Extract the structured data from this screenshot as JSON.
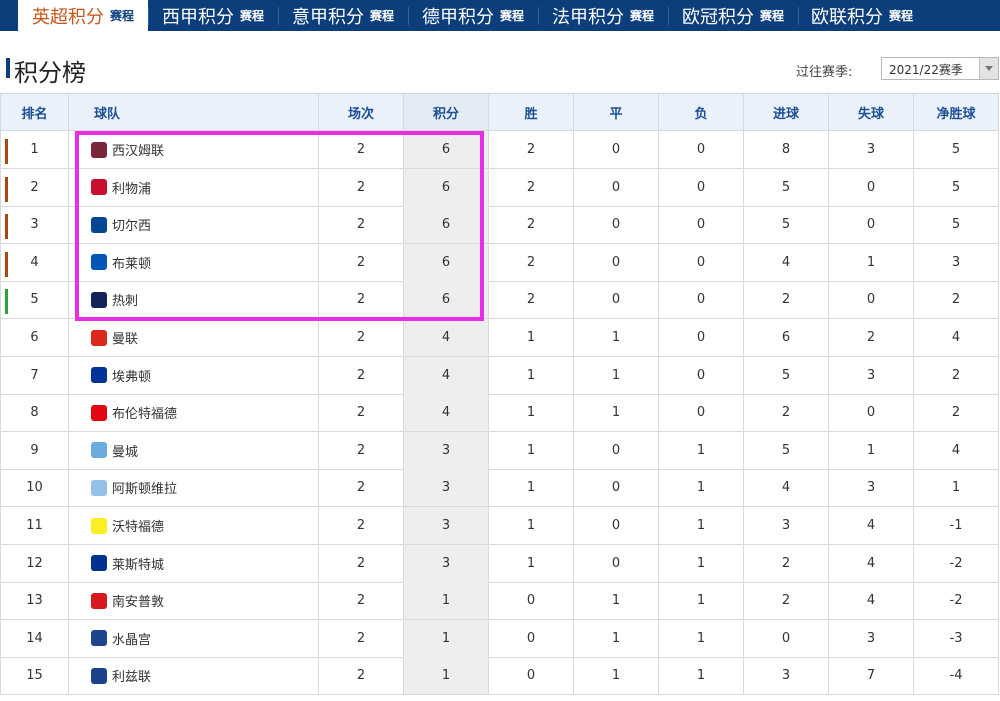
{
  "nav": [
    {
      "label": "英超积分",
      "sub": "赛程",
      "active": true
    },
    {
      "label": "西甲积分",
      "sub": "赛程",
      "active": false
    },
    {
      "label": "意甲积分",
      "sub": "赛程",
      "active": false
    },
    {
      "label": "德甲积分",
      "sub": "赛程",
      "active": false
    },
    {
      "label": "法甲积分",
      "sub": "赛程",
      "active": false
    },
    {
      "label": "欧冠积分",
      "sub": "赛程",
      "active": false
    },
    {
      "label": "欧联积分",
      "sub": "赛程",
      "active": false
    }
  ],
  "title": "积分榜",
  "season_label": "过往赛季:",
  "season_value": "2021/22赛季",
  "headers": [
    "排名",
    "球队",
    "场次",
    "积分",
    "胜",
    "平",
    "负",
    "进球",
    "失球",
    "净胜球"
  ],
  "rows": [
    {
      "rank": "1",
      "team": "西汉姆联",
      "played": "2",
      "points": "6",
      "win": "2",
      "draw": "0",
      "loss": "0",
      "gf": "8",
      "ga": "3",
      "gd": "5",
      "zone": "#a8480f",
      "crest": "#7a263a"
    },
    {
      "rank": "2",
      "team": "利物浦",
      "played": "2",
      "points": "6",
      "win": "2",
      "draw": "0",
      "loss": "0",
      "gf": "5",
      "ga": "0",
      "gd": "5",
      "zone": "#a8480f",
      "crest": "#c8102e"
    },
    {
      "rank": "3",
      "team": "切尔西",
      "played": "2",
      "points": "6",
      "win": "2",
      "draw": "0",
      "loss": "0",
      "gf": "5",
      "ga": "0",
      "gd": "5",
      "zone": "#a8480f",
      "crest": "#034694"
    },
    {
      "rank": "4",
      "team": "布莱顿",
      "played": "2",
      "points": "6",
      "win": "2",
      "draw": "0",
      "loss": "0",
      "gf": "4",
      "ga": "1",
      "gd": "3",
      "zone": "#a8480f",
      "crest": "#0057b8"
    },
    {
      "rank": "5",
      "team": "热刺",
      "played": "2",
      "points": "6",
      "win": "2",
      "draw": "0",
      "loss": "0",
      "gf": "2",
      "ga": "0",
      "gd": "2",
      "zone": "#2aa33a",
      "crest": "#132257"
    },
    {
      "rank": "6",
      "team": "曼联",
      "played": "2",
      "points": "4",
      "win": "1",
      "draw": "1",
      "loss": "0",
      "gf": "6",
      "ga": "2",
      "gd": "4",
      "zone": "",
      "crest": "#da291c"
    },
    {
      "rank": "7",
      "team": "埃弗顿",
      "played": "2",
      "points": "4",
      "win": "1",
      "draw": "1",
      "loss": "0",
      "gf": "5",
      "ga": "3",
      "gd": "2",
      "zone": "",
      "crest": "#003399"
    },
    {
      "rank": "8",
      "team": "布伦特福德",
      "played": "2",
      "points": "4",
      "win": "1",
      "draw": "1",
      "loss": "0",
      "gf": "2",
      "ga": "0",
      "gd": "2",
      "zone": "",
      "crest": "#e30613"
    },
    {
      "rank": "9",
      "team": "曼城",
      "played": "2",
      "points": "3",
      "win": "1",
      "draw": "0",
      "loss": "1",
      "gf": "5",
      "ga": "1",
      "gd": "4",
      "zone": "",
      "crest": "#6cabdd"
    },
    {
      "rank": "10",
      "team": "阿斯顿维拉",
      "played": "2",
      "points": "3",
      "win": "1",
      "draw": "0",
      "loss": "1",
      "gf": "4",
      "ga": "3",
      "gd": "1",
      "zone": "",
      "crest": "#95bfe5"
    },
    {
      "rank": "11",
      "team": "沃特福德",
      "played": "2",
      "points": "3",
      "win": "1",
      "draw": "0",
      "loss": "1",
      "gf": "3",
      "ga": "4",
      "gd": "-1",
      "zone": "",
      "crest": "#fbee23"
    },
    {
      "rank": "12",
      "team": "莱斯特城",
      "played": "2",
      "points": "3",
      "win": "1",
      "draw": "0",
      "loss": "1",
      "gf": "2",
      "ga": "4",
      "gd": "-2",
      "zone": "",
      "crest": "#003090"
    },
    {
      "rank": "13",
      "team": "南安普敦",
      "played": "2",
      "points": "1",
      "win": "0",
      "draw": "1",
      "loss": "1",
      "gf": "2",
      "ga": "4",
      "gd": "-2",
      "zone": "",
      "crest": "#d71920"
    },
    {
      "rank": "14",
      "team": "水晶宫",
      "played": "2",
      "points": "1",
      "win": "0",
      "draw": "1",
      "loss": "1",
      "gf": "0",
      "ga": "3",
      "gd": "-3",
      "zone": "",
      "crest": "#1b458f"
    },
    {
      "rank": "15",
      "team": "利兹联",
      "played": "2",
      "points": "1",
      "win": "0",
      "draw": "1",
      "loss": "1",
      "gf": "3",
      "ga": "7",
      "gd": "-4",
      "zone": "",
      "crest": "#1d428a"
    }
  ]
}
